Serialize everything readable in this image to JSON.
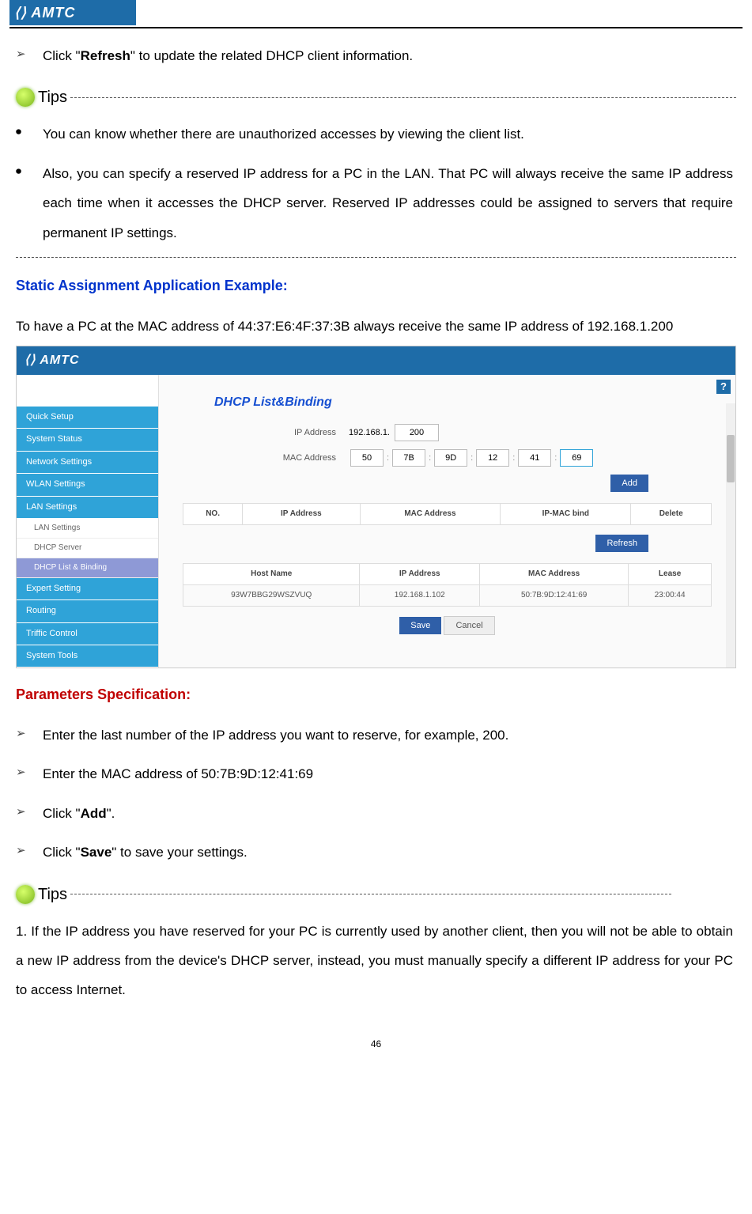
{
  "logo_text": "⟨⟩ AMTC",
  "intro_refresh_pre": "Click \"",
  "intro_refresh_bold": "Refresh",
  "intro_refresh_post": "\" to update the related DHCP client information.",
  "tips_label": "Tips",
  "tip1": "You can know whether there are unauthorized accesses by viewing the client list.",
  "tip2": "Also, you can specify a reserved IP address for a PC in the LAN. That PC will always receive the same IP address each time when it accesses the DHCP server. Reserved IP addresses could be assigned to servers that require permanent IP settings.",
  "static_head": "Static Assignment Application Example:",
  "static_body": "To have a PC at the MAC address of 44:37:E6:4F:37:3B always receive the same IP address of 192.168.1.200",
  "params_head": "Parameters Specification:",
  "p1": "Enter the last number of the IP address you want to reserve, for example, 200.",
  "p2": "Enter the MAC address of 50:7B:9D:12:41:69",
  "p3_pre": "Click \"",
  "p3_bold": "Add",
  "p3_post": "\".",
  "p4_pre": "Click \"",
  "p4_bold": "Save",
  "p4_post": "\" to save your settings.",
  "bottom_tip": "1. If the IP address you have reserved for your PC is currently used by another client, then you will not be able to obtain a new IP address from the device's DHCP server, instead, you must manually specify a different IP address for your PC to access Internet.",
  "page_num": "46",
  "shot": {
    "brand": "⟨⟩ AMTC",
    "help": "?",
    "sidebar_main": [
      "Quick Setup",
      "System Status",
      "Network Settings",
      "WLAN Settings",
      "LAN Settings"
    ],
    "sidebar_sub": [
      "LAN Settings",
      "DHCP Server",
      "DHCP List & Binding"
    ],
    "sidebar_main2": [
      "Expert Setting",
      "Routing",
      "Triffic Control",
      "System Tools"
    ],
    "title": "DHCP List&Binding",
    "ip_label": "IP Address",
    "ip_prefix": "192.168.1.",
    "ip_val": "200",
    "mac_label": "MAC Address",
    "mac": [
      "50",
      "7B",
      "9D",
      "12",
      "41",
      "69"
    ],
    "add_btn": "Add",
    "refresh_btn": "Refresh",
    "save_btn": "Save",
    "cancel_btn": "Cancel",
    "tbl1_head": [
      "NO.",
      "IP Address",
      "MAC Address",
      "IP-MAC bind",
      "Delete"
    ],
    "tbl2_head": [
      "Host Name",
      "IP Address",
      "MAC Address",
      "Lease"
    ],
    "tbl2_row": [
      "93W7BBG29WSZVUQ",
      "192.168.1.102",
      "50:7B:9D:12:41:69",
      "23:00:44"
    ]
  },
  "chart_data": {
    "type": "table",
    "title": "DHCP client list",
    "columns": [
      "Host Name",
      "IP Address",
      "MAC Address",
      "Lease"
    ],
    "rows": [
      [
        "93W7BBG29WSZVUQ",
        "192.168.1.102",
        "50:7B:9D:12:41:69",
        "23:00:44"
      ]
    ]
  }
}
